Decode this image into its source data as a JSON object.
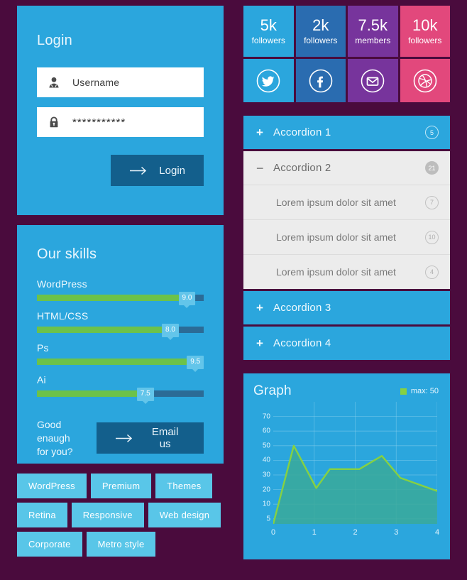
{
  "theme": {
    "background": "#4a0b3d",
    "panel_blue": "#2ba6dd",
    "button_dark": "#135f8c",
    "skill_green": "#6cc24a",
    "skill_track": "#2b6b96",
    "tooltip_blue": "#63c5ea",
    "tag_blue": "#59c6e8",
    "accordion_open_bg": "#ececec",
    "graph_line": "#86d142"
  },
  "login": {
    "title": "Login",
    "username": {
      "value": "Username",
      "icon": "user-icon"
    },
    "password": {
      "value": "***********",
      "icon": "lock-icon"
    },
    "submit_label": "Login"
  },
  "skills": {
    "title": "Our skills",
    "items": [
      {
        "name": "WordPress",
        "value": "9.0",
        "percent": 90
      },
      {
        "name": "HTML/CSS",
        "value": "8.0",
        "percent": 80
      },
      {
        "name": "Ps",
        "value": "9.5",
        "percent": 95
      },
      {
        "name": "Ai",
        "value": "7.5",
        "percent": 75
      }
    ],
    "footer_question_line1": "Good enaugh",
    "footer_question_line2": "for you?",
    "footer_button_label": "Email us"
  },
  "tags": [
    "WordPress",
    "Premium",
    "Themes",
    "Retina",
    "Responsive",
    "Web design",
    "Corporate",
    "Metro style"
  ],
  "social": {
    "counters": [
      {
        "number": "5k",
        "label": "followers",
        "color": "#2ba6dd"
      },
      {
        "number": "2k",
        "label": "followers",
        "color": "#2a6cb0"
      },
      {
        "number": "7.5k",
        "label": "members",
        "color": "#77349c"
      },
      {
        "number": "10k",
        "label": "followers",
        "color": "#e2487c"
      }
    ],
    "icons": [
      {
        "name": "twitter-icon",
        "color": "#2ba6dd"
      },
      {
        "name": "facebook-icon",
        "color": "#2a6cb0"
      },
      {
        "name": "email-icon",
        "color": "#77349c"
      },
      {
        "name": "dribbble-icon",
        "color": "#e2487c"
      }
    ]
  },
  "accordion": [
    {
      "title": "Accordion 1",
      "sign": "+",
      "badge": "5",
      "open": false
    },
    {
      "title": "Accordion 2",
      "sign": "−",
      "badge": "21",
      "open": true,
      "items": [
        {
          "text": "Lorem ipsum dolor sit amet",
          "badge": "7"
        },
        {
          "text": "Lorem ipsum dolor sit amet",
          "badge": "10"
        },
        {
          "text": "Lorem ipsum dolor sit amet",
          "badge": "4"
        }
      ]
    },
    {
      "title": "Accordion 3",
      "sign": "+",
      "badge": "",
      "open": false
    },
    {
      "title": "Accordion 4",
      "sign": "+",
      "badge": "",
      "open": false
    }
  ],
  "graph": {
    "title": "Graph",
    "legend_label": "max: 50"
  },
  "chart_data": {
    "type": "area",
    "title": "Graph",
    "xlabel": "",
    "ylabel": "",
    "legend": [
      "max: 50"
    ],
    "legend_position": "top-right",
    "grid": true,
    "xlim": [
      0,
      4
    ],
    "ylim": [
      0,
      70
    ],
    "xticks": [
      0,
      1,
      2,
      3,
      4
    ],
    "yticks": [
      5,
      10,
      20,
      30,
      40,
      50,
      60,
      70
    ],
    "y_axis_note": "non-linear bottom: 5 then even steps of 10 up to 70",
    "series": [
      {
        "name": "max: 50",
        "line_color": "#86d142",
        "fill_color": "#3aa99a",
        "points": [
          {
            "x": 0.0,
            "y": 0
          },
          {
            "x": 0.5,
            "y": 50
          },
          {
            "x": 1.05,
            "y": 21
          },
          {
            "x": 1.38,
            "y": 34
          },
          {
            "x": 2.1,
            "y": 34
          },
          {
            "x": 2.65,
            "y": 43
          },
          {
            "x": 3.1,
            "y": 28
          },
          {
            "x": 4.0,
            "y": 19
          }
        ]
      }
    ]
  }
}
